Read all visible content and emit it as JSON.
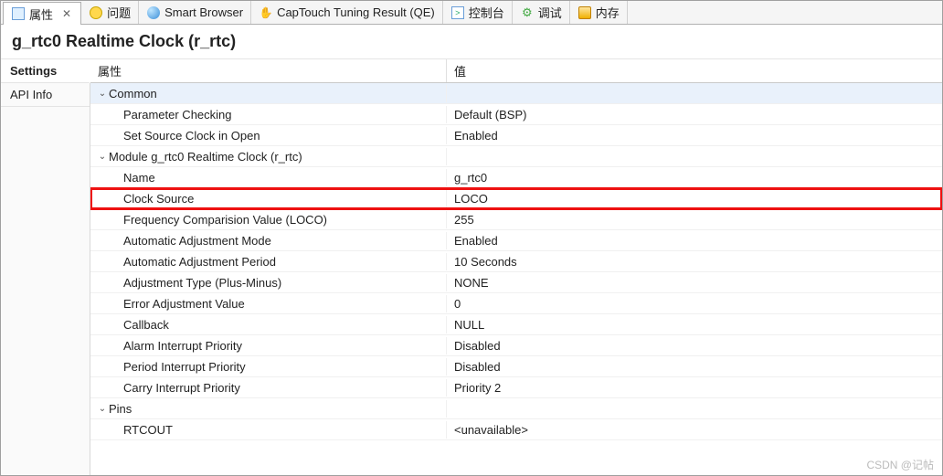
{
  "tabs": [
    {
      "label": "属性",
      "active": true,
      "closable": true
    },
    {
      "label": "问题"
    },
    {
      "label": "Smart Browser"
    },
    {
      "label": "CapTouch Tuning Result (QE)"
    },
    {
      "label": "控制台"
    },
    {
      "label": "调试"
    },
    {
      "label": "内存"
    }
  ],
  "title": "g_rtc0 Realtime Clock (r_rtc)",
  "left_nav": {
    "settings": "Settings",
    "api_info": "API Info"
  },
  "columns": {
    "prop": "属性",
    "val": "值"
  },
  "tree": {
    "common": {
      "label": "Common",
      "items": [
        {
          "name": "Parameter Checking",
          "value": "Default (BSP)"
        },
        {
          "name": "Set Source Clock in Open",
          "value": "Enabled"
        }
      ]
    },
    "module": {
      "label": "Module g_rtc0 Realtime Clock (r_rtc)",
      "items": [
        {
          "name": "Name",
          "value": "g_rtc0"
        },
        {
          "name": "Clock Source",
          "value": "LOCO",
          "hl": true
        },
        {
          "name": "Frequency Comparision Value (LOCO)",
          "value": "255"
        },
        {
          "name": "Automatic Adjustment Mode",
          "value": "Enabled"
        },
        {
          "name": "Automatic Adjustment Period",
          "value": "10 Seconds"
        },
        {
          "name": "Adjustment Type (Plus-Minus)",
          "value": "NONE"
        },
        {
          "name": "Error Adjustment Value",
          "value": "0"
        },
        {
          "name": "Callback",
          "value": "NULL"
        },
        {
          "name": "Alarm Interrupt Priority",
          "value": "Disabled"
        },
        {
          "name": "Period Interrupt Priority",
          "value": "Disabled"
        },
        {
          "name": "Carry Interrupt Priority",
          "value": "Priority 2"
        }
      ]
    },
    "pins": {
      "label": "Pins",
      "items": [
        {
          "name": "RTCOUT",
          "value": "<unavailable>"
        }
      ]
    }
  },
  "watermark": "CSDN @记帖"
}
